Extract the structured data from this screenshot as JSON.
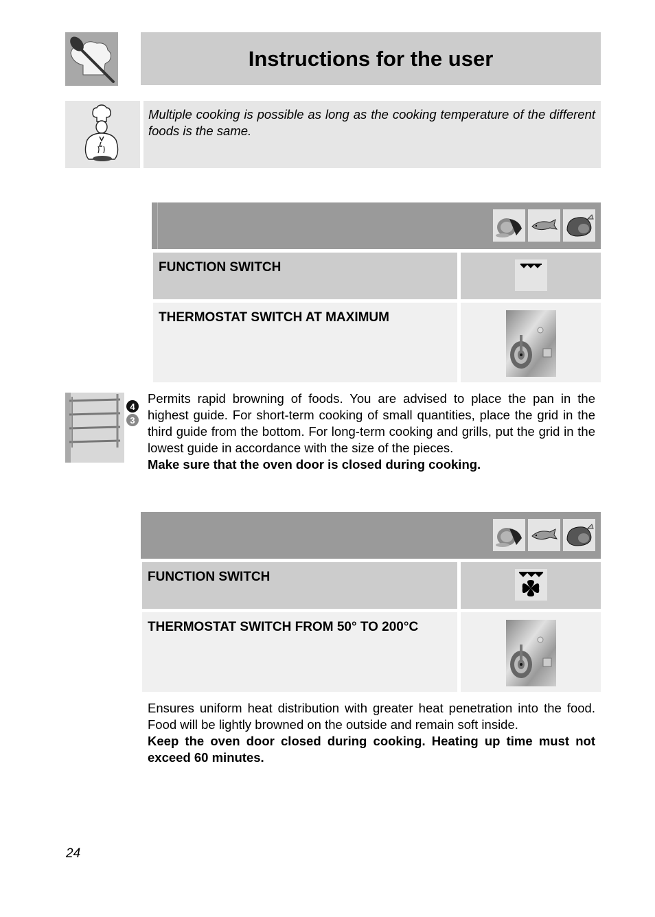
{
  "header": {
    "title": "Instructions for the user",
    "logo_icon": "spoon-and-chef-hat-icon"
  },
  "note": {
    "icon": "chef-cooking-icon",
    "text": "Multiple cooking is possible as long as the cooking temperature of the different foods is the same."
  },
  "sections": [
    {
      "food_icons": [
        "meat-icon",
        "fish-icon",
        "poultry-icon"
      ],
      "rows": [
        {
          "label": "FUNCTION SWITCH",
          "icon": "top-heating-element-icon"
        },
        {
          "label": "THERMOSTAT SWITCH AT MAXIMUM",
          "icon": "thermostat-knob-icon"
        }
      ],
      "side_icon": "oven-rack-guides-icon",
      "rack_markers": [
        "4",
        "3"
      ],
      "description": "Permits rapid browning of foods. You are advised to place the pan in the highest guide. For short-term cooking of small quantities, place the grid in the third guide from the bottom. For long-term cooking and grills, put the grid in the lowest guide in accordance with the size of the pieces.",
      "warning": "Make sure that the oven door is closed during cooking."
    },
    {
      "food_icons": [
        "meat-icon",
        "fish-icon",
        "poultry-icon"
      ],
      "rows": [
        {
          "label": "FUNCTION SWITCH",
          "icon": "top-element-with-fan-icon"
        },
        {
          "label": "THERMOSTAT SWITCH FROM 50° TO 200°C",
          "icon": "thermostat-knob-icon"
        }
      ],
      "description": "Ensures uniform heat distribution with greater heat penetration into the food. Food will be lightly browned on the outside and remain soft inside.",
      "warning": "Keep the oven door closed during cooking. Heating up time must not exceed 60 minutes."
    }
  ],
  "footer": {
    "page_number": "24"
  }
}
